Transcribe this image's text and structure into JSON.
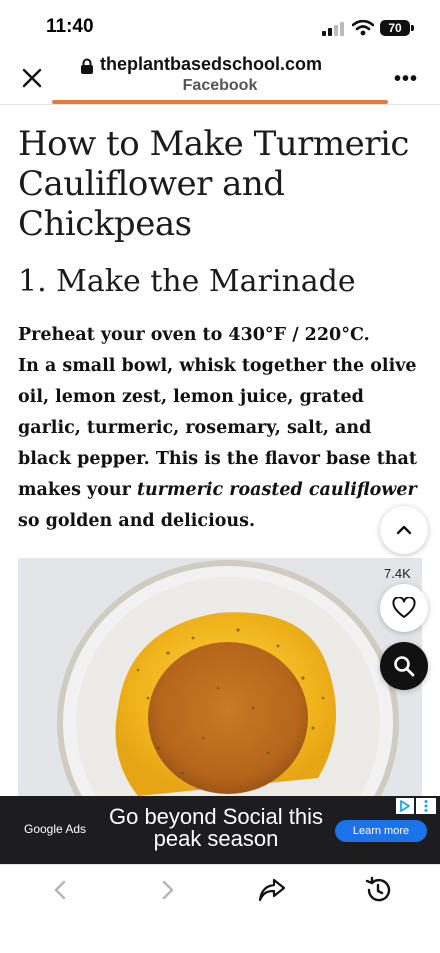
{
  "status_bar": {
    "time": "11:40",
    "battery": "70"
  },
  "browser": {
    "domain": "theplantbasedschool.com",
    "source": "Facebook"
  },
  "article": {
    "title": "How to Make Turmeric Cauliflower and Chickpeas",
    "step_heading": "1. Make the Marinade",
    "p1_prefix": "Preheat your oven to ",
    "p1_temp": "430°F / 220°C",
    "p1_suffix": ".",
    "p2_main": "In a small bowl, whisk together the olive oil, lemon zest, lemon juice, grated garlic, turmeric, rosemary, salt, and black pepper. This is the flavor base that makes your ",
    "p2_italic": "turmeric roasted cauliflower",
    "p2_end": " so golden and delicious."
  },
  "image": {
    "counter": "7.4K"
  },
  "ad": {
    "brand": "Google Ads",
    "headline": "Go beyond Social this peak season",
    "cta": "Learn more"
  },
  "colors": {
    "accent_bar": "#e27a3e",
    "ad_bg": "#1d1d1f",
    "cta": "#1a73e8"
  }
}
